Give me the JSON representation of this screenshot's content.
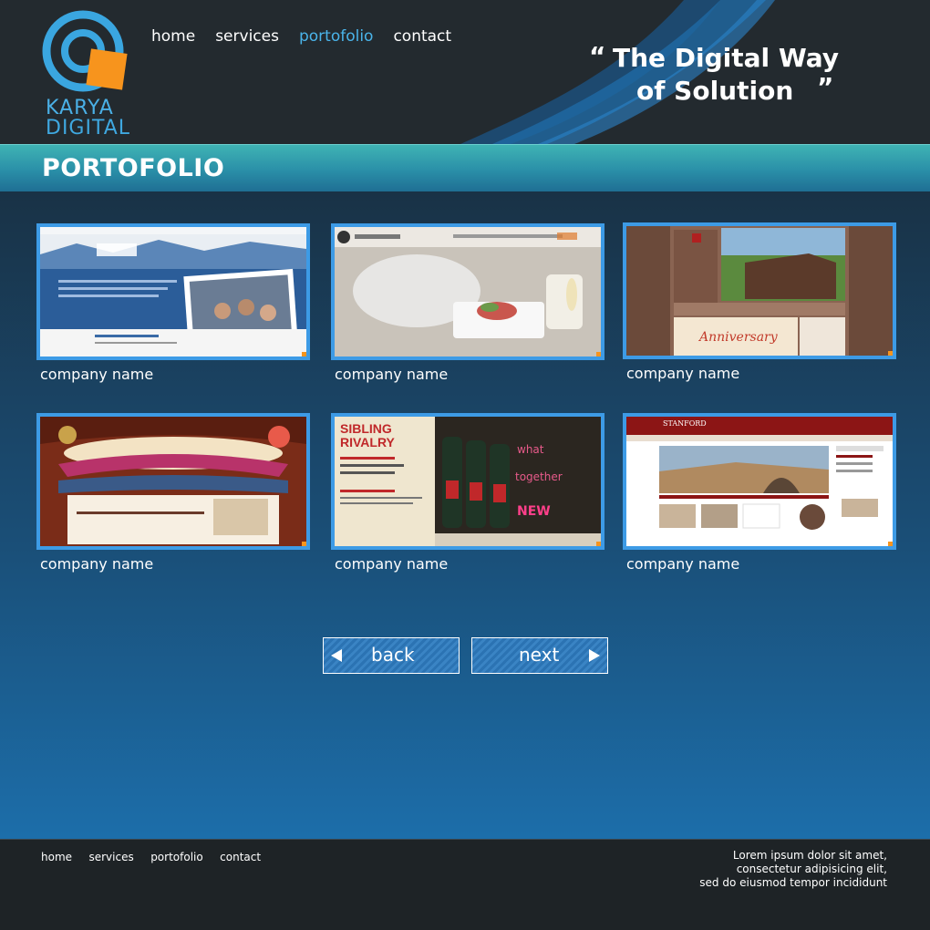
{
  "brand": {
    "line1": "KARYA",
    "line2": "DIGITAL"
  },
  "nav": {
    "items": [
      "home",
      "services",
      "portofolio",
      "contact"
    ],
    "active": "portofolio"
  },
  "tagline": {
    "open_quote": "“",
    "line1": "The Digital Way",
    "line2": "of Solution",
    "close_quote": "”"
  },
  "page_title": "PORTOFOLIO",
  "portfolio": {
    "items": [
      {
        "caption": "company name",
        "thumb": "asheville-school-site"
      },
      {
        "caption": "company name",
        "thumb": "innovative-cuisine-site"
      },
      {
        "caption": "company name",
        "thumb": "japanese-resort-site"
      },
      {
        "caption": "company name",
        "thumb": "japanese-franchise-site"
      },
      {
        "caption": "company name",
        "thumb": "sibling-rivalry-site"
      },
      {
        "caption": "company name",
        "thumb": "stanford-university-site"
      }
    ]
  },
  "pager": {
    "back": "back",
    "next": "next"
  },
  "footer": {
    "nav": [
      "home",
      "services",
      "portofolio",
      "contact"
    ],
    "text": [
      "Lorem ipsum dolor sit amet,",
      "consectetur adipisicing elit,",
      "sed do eiusmod tempor incididunt"
    ]
  },
  "colors": {
    "accent": "#4ab4ea",
    "orange": "#f7941d",
    "thumb_border": "#3d9be6"
  }
}
